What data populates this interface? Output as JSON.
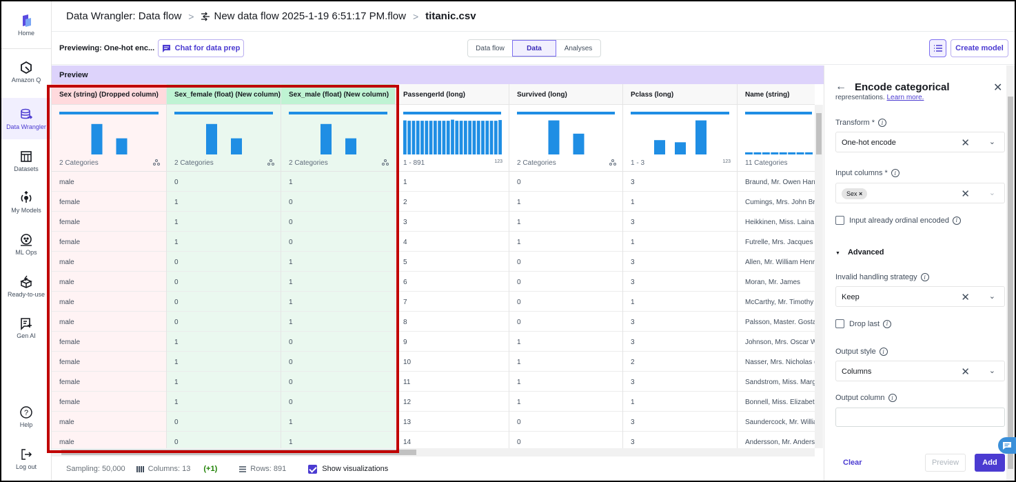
{
  "sidebar": {
    "items": [
      {
        "label": "Home",
        "icon": "home-logo-icon"
      },
      {
        "label": "Amazon Q",
        "icon": "amazon-q-icon"
      },
      {
        "label": "Data Wrangler",
        "icon": "data-wrangler-icon",
        "active": true
      },
      {
        "label": "Datasets",
        "icon": "datasets-icon"
      },
      {
        "label": "My Models",
        "icon": "my-models-icon"
      },
      {
        "label": "ML Ops",
        "icon": "ml-ops-icon"
      },
      {
        "label": "Ready-to-use",
        "icon": "ready-to-use-icon"
      },
      {
        "label": "Gen AI",
        "icon": "gen-ai-icon"
      },
      {
        "label": "Help",
        "icon": "help-icon"
      },
      {
        "label": "Log out",
        "icon": "log-out-icon"
      }
    ]
  },
  "breadcrumb": {
    "root": "Data Wrangler: Data flow",
    "flow": "New data flow 2025-1-19 6:51:17 PM.flow",
    "file": "titanic.csv"
  },
  "toolbar": {
    "previewing": "Previewing: One-hot enc...",
    "chat_button": "Chat for data prep",
    "tabs": [
      "Data flow",
      "Data",
      "Analyses"
    ],
    "active_tab": "Data",
    "create_model": "Create model"
  },
  "preview": {
    "title": "Preview",
    "columns": [
      {
        "header": "Sex (string) (Dropped column)",
        "status": "dropped",
        "summary": "2 Categories",
        "summary_icon": "categorical-icon",
        "hist": [
          0.85,
          0.45
        ],
        "cells": [
          "male",
          "female",
          "female",
          "female",
          "male",
          "male",
          "male",
          "male",
          "female",
          "female",
          "female",
          "female",
          "male",
          "male"
        ]
      },
      {
        "header": "Sex_female (float) (New column)",
        "status": "new",
        "summary": "2 Categories",
        "summary_icon": "categorical-icon",
        "hist": [
          0.85,
          0.45
        ],
        "cells": [
          "0",
          "1",
          "1",
          "1",
          "0",
          "0",
          "0",
          "0",
          "1",
          "1",
          "1",
          "1",
          "0",
          "0"
        ]
      },
      {
        "header": "Sex_male (float) (New column)",
        "status": "new",
        "summary": "2 Categories",
        "summary_icon": "categorical-icon",
        "hist": [
          0.85,
          0.45
        ],
        "cells": [
          "1",
          "0",
          "0",
          "0",
          "1",
          "1",
          "1",
          "1",
          "0",
          "0",
          "0",
          "0",
          "1",
          "1"
        ]
      },
      {
        "header": "PassengerId (long)",
        "status": "normal",
        "summary": "1 - 891",
        "summary_icon": "123",
        "hist": [
          0.95,
          0.94,
          0.94,
          0.94,
          0.94,
          0.94,
          0.94,
          0.94,
          0.94,
          0.94,
          0.94,
          0.97,
          0.94,
          0.94,
          0.94,
          0.94,
          0.94,
          0.94,
          0.94,
          0.94,
          0.94,
          0.94,
          0.96
        ],
        "cells": [
          "1",
          "2",
          "3",
          "4",
          "5",
          "6",
          "7",
          "8",
          "9",
          "10",
          "11",
          "12",
          "13",
          "14"
        ]
      },
      {
        "header": "Survived (long)",
        "status": "normal",
        "summary": "2 Categories",
        "summary_icon": "categorical-icon",
        "hist": [
          0.95,
          0.58
        ],
        "cells": [
          "0",
          "1",
          "1",
          "1",
          "0",
          "0",
          "0",
          "0",
          "1",
          "1",
          "1",
          "1",
          "0",
          "0"
        ]
      },
      {
        "header": "Pclass (long)",
        "status": "normal",
        "summary": "1 - 3",
        "summary_icon": "123",
        "hist": [
          0.4,
          0.34,
          0.95
        ],
        "cells": [
          "3",
          "1",
          "3",
          "1",
          "3",
          "3",
          "1",
          "3",
          "3",
          "2",
          "3",
          "1",
          "3",
          "3"
        ]
      },
      {
        "header": "Name (string)",
        "status": "normal",
        "summary": "11 Categories",
        "summary_icon": "categorical-icon",
        "hist": [
          0.06,
          0.06,
          0.06,
          0.06,
          0.06,
          0.06,
          0.06,
          0.06
        ],
        "cells": [
          "Braund, Mr. Owen Harris",
          "Cumings, Mrs. John Bradley",
          "Heikkinen, Miss. Laina",
          "Futrelle, Mrs. Jacques Heath",
          "Allen, Mr. William Henry",
          "Moran, Mr. James",
          "McCarthy, Mr. Timothy J",
          "Palsson, Master. Gosta Leonard",
          "Johnson, Mrs. Oscar W (Elisabeth",
          "Nasser, Mrs. Nicholas (Adele",
          "Sandstrom, Miss. Marguerite",
          "Bonnell, Miss. Elizabeth",
          "Saundercock, Mr. William Henry",
          "Andersson, Mr. Anders Johan"
        ]
      }
    ]
  },
  "footer": {
    "sampling": "Sampling: 50,000",
    "columns": "Columns: 13",
    "columns_delta": "(+1)",
    "rows": "Rows: 891",
    "show_viz": "Show visualizations",
    "show_viz_checked": true
  },
  "panel": {
    "title": "Encode categorical",
    "subtitle": "representations.",
    "learn_more": "Learn more.",
    "transform_label": "Transform *",
    "transform_value": "One-hot encode",
    "input_columns_label": "Input columns *",
    "input_columns_chip": "Sex",
    "ordinal_label": "Input already ordinal encoded",
    "advanced_label": "Advanced",
    "invalid_label": "Invalid handling strategy",
    "invalid_value": "Keep",
    "drop_last_label": "Drop last",
    "output_style_label": "Output style",
    "output_style_value": "Columns",
    "output_column_label": "Output column",
    "output_column_value": "",
    "clear": "Clear",
    "preview": "Preview",
    "add": "Add"
  },
  "colors": {
    "accent": "#4b3bd1",
    "bar": "#1f8ee4",
    "dropped_bg": "#fff3f4",
    "new_bg": "#eaf8ef",
    "highlight": "#c00000"
  }
}
